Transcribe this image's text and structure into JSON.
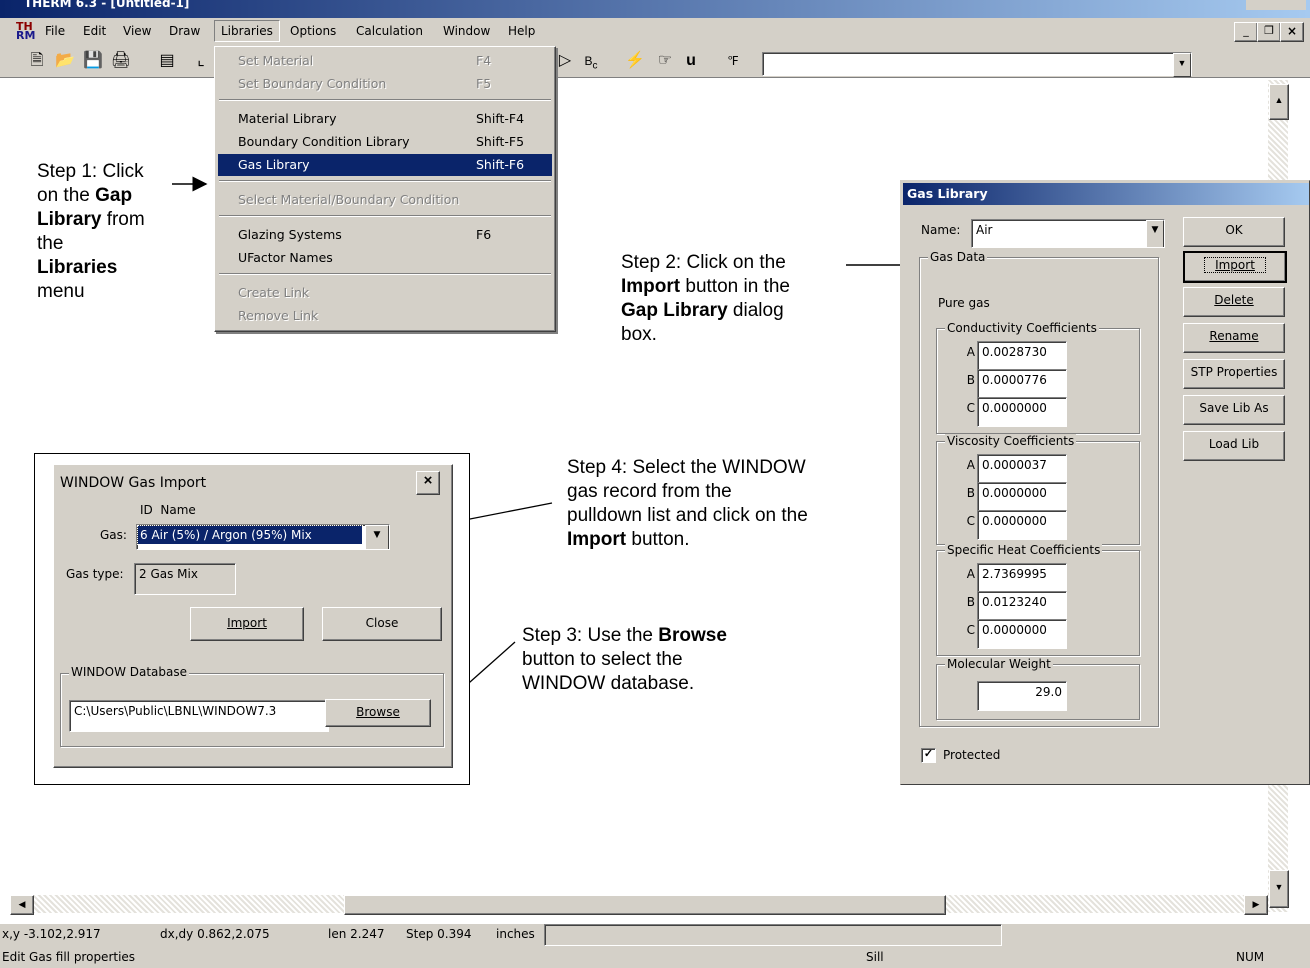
{
  "app": {
    "title": "THERM 6.3 - [Untitled-1]",
    "menubar": [
      "File",
      "Edit",
      "View",
      "Draw",
      "Libraries",
      "Options",
      "Calculation",
      "Window",
      "Help"
    ]
  },
  "libraries_menu": {
    "items": [
      {
        "label": "Set Material",
        "key": "F4",
        "enabled": false
      },
      {
        "label": "Set Boundary Condition",
        "key": "F5",
        "enabled": false
      },
      {
        "label": "Material Library",
        "key": "Shift-F4",
        "enabled": true
      },
      {
        "label": "Boundary Condition Library",
        "key": "Shift-F5",
        "enabled": true
      },
      {
        "label": "Gas Library",
        "key": "Shift-F6",
        "enabled": true,
        "selected": true
      },
      {
        "label": "Select Material/Boundary Condition",
        "key": "",
        "enabled": false
      },
      {
        "label": "Glazing Systems",
        "key": "F6",
        "enabled": true
      },
      {
        "label": "UFactor Names",
        "key": "",
        "enabled": true
      },
      {
        "label": "Create Link",
        "key": "",
        "enabled": false
      },
      {
        "label": "Remove Link",
        "key": "",
        "enabled": false
      }
    ]
  },
  "annotations": {
    "step1": {
      "a": "Step 1: Click",
      "b": "on the ",
      "c": "Gap",
      "d": "Library",
      "e": " from",
      "f": "the",
      "g": "Libraries",
      "h": "menu"
    },
    "step2": {
      "a": "Step 2: Click on the",
      "b": "Import",
      "c": " button in the",
      "d": "Gap Library",
      "e": " dialog",
      "f": "box."
    },
    "step3": {
      "a": "Step 3: Use the ",
      "b": "Browse",
      "c": "button to select the",
      "d": "WINDOW database."
    },
    "step4": {
      "a": "Step 4: Select the WINDOW",
      "b": "gas record from the",
      "c": "pulldown list and click on the",
      "d": "Import",
      "e": " button."
    }
  },
  "gas_library": {
    "title": "Gas Library",
    "name_label": "Name:",
    "name_value": "Air",
    "gas_data_label": "Gas Data",
    "pure_gas": "Pure gas",
    "conductivity": {
      "label": "Conductivity Coefficients",
      "A": "0.0028730",
      "B": "0.0000776",
      "C": "0.0000000"
    },
    "viscosity": {
      "label": "Viscosity Coefficients",
      "A": "0.0000037",
      "B": "0.0000000",
      "C": "0.0000000"
    },
    "specific_heat": {
      "label": "Specific Heat Coefficients",
      "A": "2.7369995",
      "B": "0.0123240",
      "C": "0.0000000"
    },
    "molecular_weight": {
      "label": "Molecular Weight",
      "value": "29.0"
    },
    "coef_letters": {
      "a": "A",
      "b": "B",
      "c": "C"
    },
    "protected_label": "Protected",
    "protected_checked": true,
    "buttons": {
      "ok": "OK",
      "import": "Import",
      "delete": "Delete",
      "rename": "Rename",
      "stp": "STP Properties",
      "save": "Save Lib As",
      "load": "Load Lib"
    }
  },
  "gas_import": {
    "title": "WINDOW Gas Import",
    "header": "ID  Name",
    "gas_label": "Gas:",
    "gas_value": "6 Air (5%) / Argon (95%) Mix",
    "gas_type_label": "Gas type:",
    "gas_type_value": "2 Gas Mix",
    "import_button": "Import",
    "close_button": "Close",
    "database_label": "WINDOW Database",
    "database_path": "C:\\Users\\Public\\LBNL\\WINDOW7.3",
    "browse_button": "Browse"
  },
  "statusbar": {
    "xy": "x,y -3.102,2.917",
    "dxdy": "dx,dy 0.862,2.075",
    "len": "len 2.247",
    "step": "Step 0.394",
    "units": "inches",
    "message": "Edit Gas fill properties",
    "sill": "Sill",
    "num": "NUM"
  },
  "colors": {
    "menu_highlight": "#0a246a",
    "dialog_face": "#d4d0c8",
    "title_gradient_start": "#0a246a",
    "title_gradient_end": "#a6caf0"
  }
}
